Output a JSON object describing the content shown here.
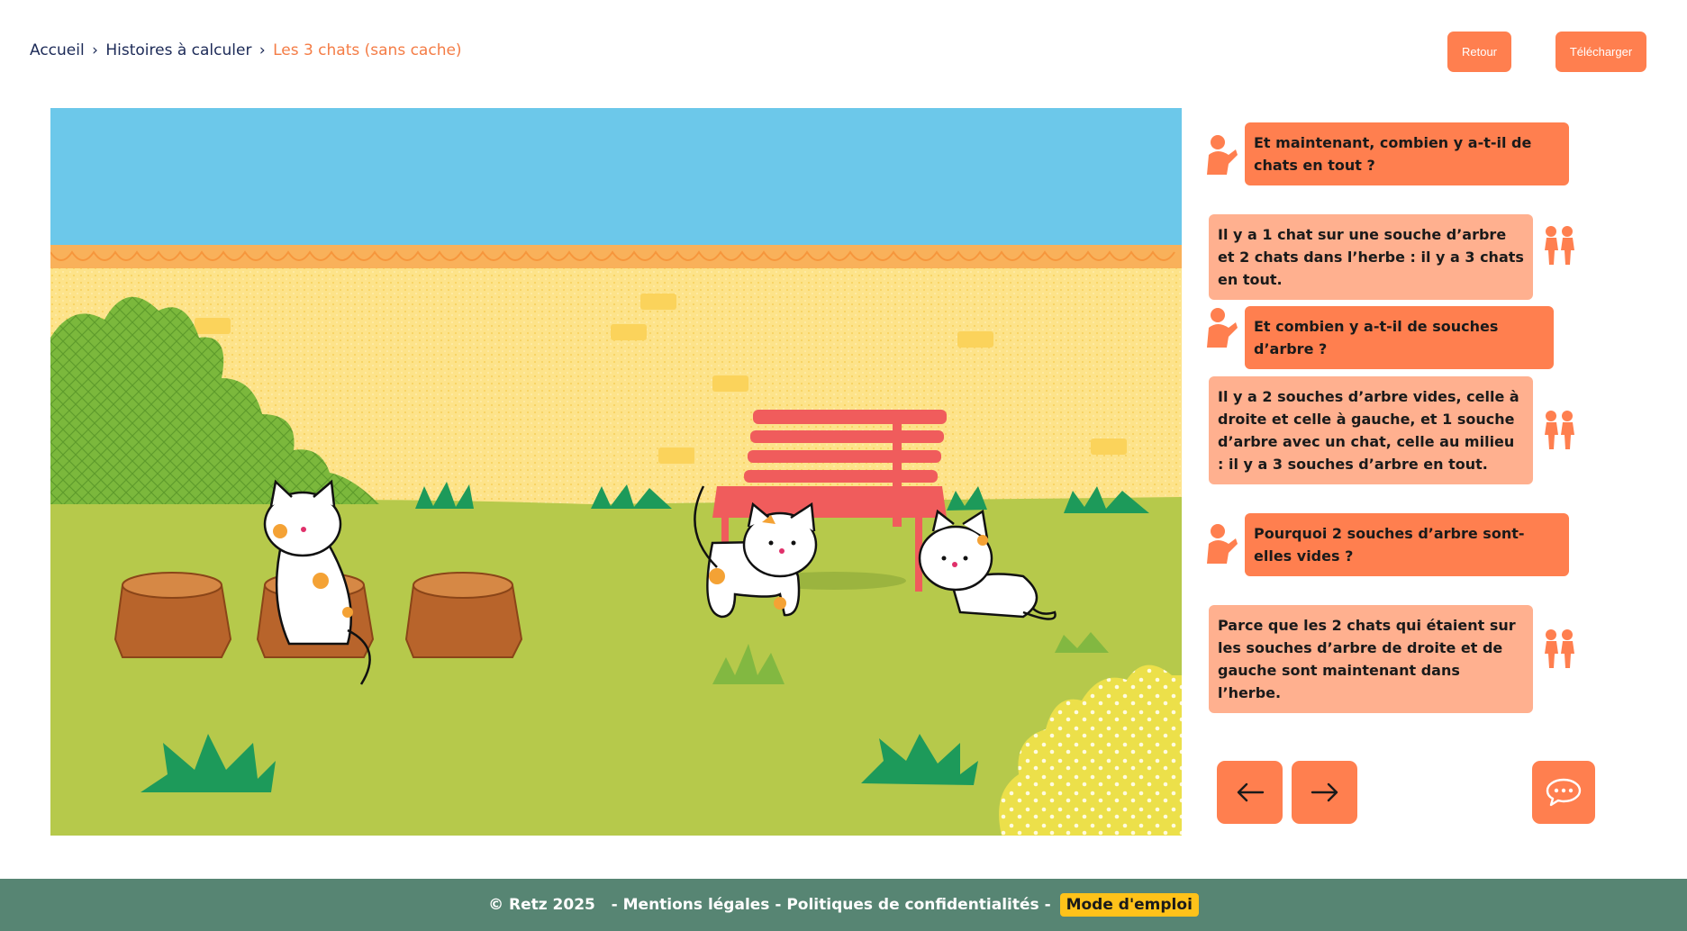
{
  "breadcrumb": {
    "home": "Accueil",
    "section": "Histoires à calculer",
    "current": "Les 3 chats (sans cache)",
    "separator": "›"
  },
  "header": {
    "back_label": "Retour",
    "download_label": "Télécharger"
  },
  "dialog": [
    {
      "speaker": "teacher",
      "text": "Et maintenant, combien y a-t-il de chats en tout ?"
    },
    {
      "speaker": "kids",
      "text": "Il y a 1 chat sur une souche d’arbre et 2 chats dans l’herbe : il y a 3 chats en tout."
    },
    {
      "speaker": "teacher",
      "text": "Et combien y a-t-il de souches d’arbre ?"
    },
    {
      "speaker": "kids",
      "text": "Il y a 2 souches d’arbre vides, celle à droite et celle à gauche, et 1 souche d’arbre avec un chat, celle au milieu : il y a 3 souches d’arbre en tout."
    },
    {
      "speaker": "teacher",
      "text": "Pourquoi 2 souches d’arbre sont-elles vides ?"
    },
    {
      "speaker": "kids",
      "text": "Parce que les 2 chats qui étaient sur les souches d’arbre de droite et de gauche sont maintenant dans l’herbe."
    }
  ],
  "controls": {
    "prev_icon": "arrow-left-icon",
    "next_icon": "arrow-right-icon",
    "chat_icon": "speech-bubble-icon"
  },
  "footer": {
    "copyright": "© Retz 2025",
    "legal": "Mentions légales",
    "privacy": "Politiques de confidentialités",
    "separator": " - ",
    "mode": "Mode d'emploi"
  },
  "colors": {
    "accent": "#ff7f4f",
    "accent_light": "#ffb08f",
    "footer_bg": "#578573",
    "mode_bg": "#ffc21a",
    "breadcrumb": "#1c2a57",
    "breadcrumb_current": "#f47c45"
  }
}
